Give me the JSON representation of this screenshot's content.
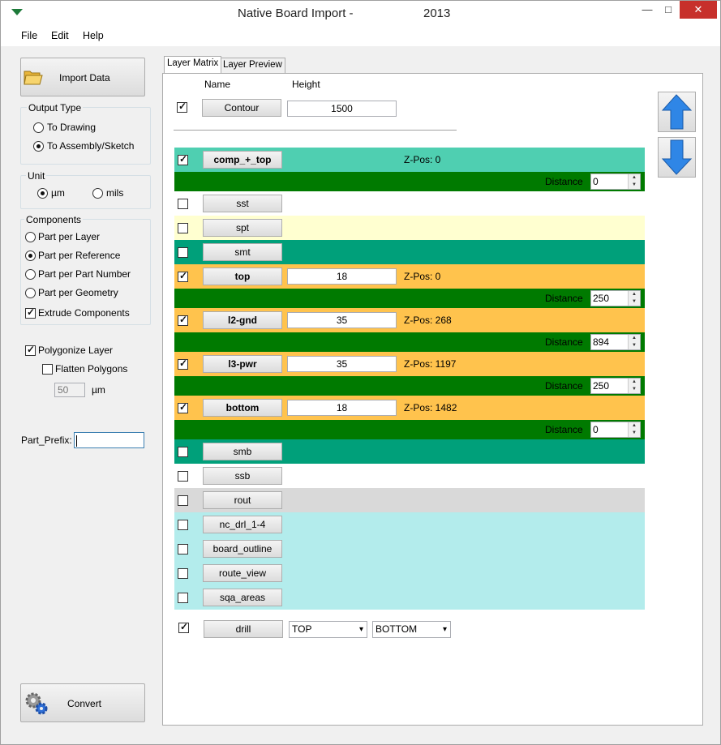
{
  "window": {
    "title": "Native Board Import -",
    "title_suffix": "2013",
    "minimize_glyph": "—",
    "maximize_glyph": "□",
    "close_glyph": "✕"
  },
  "menu": {
    "file": "File",
    "edit": "Edit",
    "help": "Help"
  },
  "left": {
    "import_label": "Import Data",
    "output_type": {
      "title": "Output Type",
      "to_drawing": "To Drawing",
      "to_assembly": "To Assembly/Sketch",
      "selected": "To Assembly/Sketch"
    },
    "unit": {
      "title": "Unit",
      "um": "µm",
      "mils": "mils",
      "selected": "µm"
    },
    "components": {
      "title": "Components",
      "part_per_layer": "Part per Layer",
      "part_per_reference": "Part per Reference",
      "part_per_part_number": "Part per Part Number",
      "part_per_geometry": "Part per Geometry",
      "selected": "Part per Reference",
      "extrude_label": "Extrude Components",
      "extrude_checked": true
    },
    "polygonize_label": "Polygonize Layer",
    "polygonize_checked": true,
    "flatten_label": "Flatten Polygons",
    "flatten_checked": false,
    "flatten_value": "50",
    "flatten_unit": "µm",
    "prefix_label": "Part_Prefix:",
    "prefix_value": "",
    "convert_label": "Convert"
  },
  "tabs": {
    "layer_matrix": "Layer Matrix",
    "layer_preview": "Layer Preview"
  },
  "matrix": {
    "name_header": "Name",
    "height_header": "Height",
    "contour": {
      "label": "Contour",
      "height": "1500",
      "checked": true
    },
    "distance_label": "Distance",
    "layers": [
      {
        "name": "comp_+_top",
        "checked": true,
        "bold": true,
        "bg": "#4fcfb1",
        "zpos": "Z-Pos: 0",
        "height": "",
        "distance": "0"
      },
      {
        "name": "sst",
        "checked": false,
        "bold": false,
        "bg": "#ffffff"
      },
      {
        "name": "spt",
        "checked": false,
        "bold": false,
        "bg": "#ffffd0"
      },
      {
        "name": "smt",
        "checked": false,
        "bold": false,
        "bg": "#00a07a"
      },
      {
        "name": "top",
        "checked": true,
        "bold": true,
        "bg": "#ffc34d",
        "height": "18",
        "zpos": "Z-Pos: 0",
        "distance": "250"
      },
      {
        "name": "l2-gnd",
        "checked": true,
        "bold": true,
        "bg": "#ffc34d",
        "height": "35",
        "zpos": "Z-Pos: 268",
        "distance": "894"
      },
      {
        "name": "l3-pwr",
        "checked": true,
        "bold": true,
        "bg": "#ffc34d",
        "height": "35",
        "zpos": "Z-Pos: 1197",
        "distance": "250"
      },
      {
        "name": "bottom",
        "checked": true,
        "bold": true,
        "bg": "#ffc34d",
        "height": "18",
        "zpos": "Z-Pos: 1482",
        "distance": "0"
      },
      {
        "name": "smb",
        "checked": false,
        "bold": false,
        "bg": "#00a07a"
      },
      {
        "name": "ssb",
        "checked": false,
        "bold": false,
        "bg": "#ffffff"
      },
      {
        "name": "rout",
        "checked": false,
        "bold": false,
        "bg": "#d9d9d9"
      },
      {
        "name": "nc_drl_1-4",
        "checked": false,
        "bold": false,
        "bg": "#b3ecec"
      },
      {
        "name": "board_outline",
        "checked": false,
        "bold": false,
        "bg": "#b3ecec"
      },
      {
        "name": "route_view",
        "checked": false,
        "bold": false,
        "bg": "#b3ecec"
      },
      {
        "name": "sqa_areas",
        "checked": false,
        "bold": false,
        "bg": "#b3ecec"
      }
    ],
    "distance_bar_color": "#007a00",
    "drill": {
      "label": "drill",
      "checked": true,
      "from": "TOP",
      "to": "BOTTOM"
    }
  }
}
